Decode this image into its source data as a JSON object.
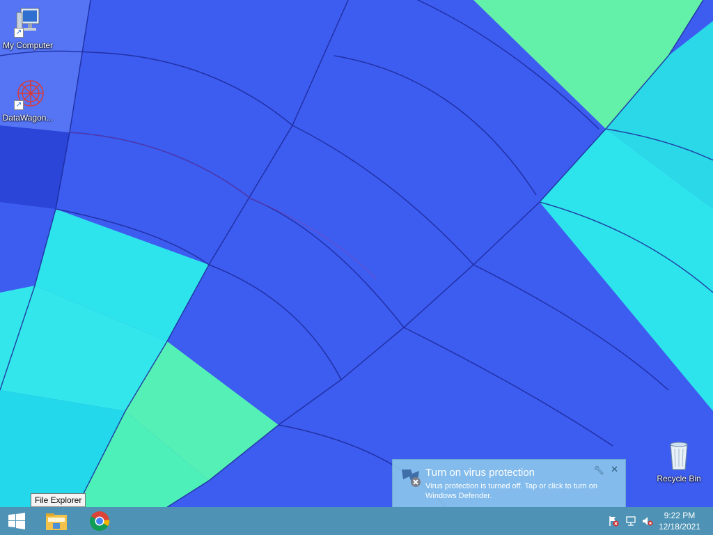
{
  "desktop": {
    "icons": [
      {
        "label": "My Computer"
      },
      {
        "label": "DataWagon..."
      },
      {
        "label": "Recycle Bin"
      }
    ]
  },
  "tooltip": {
    "text": "File Explorer"
  },
  "notification": {
    "title": "Turn on virus protection",
    "body": "Virus protection is turned off. Tap or click to turn on Windows Defender."
  },
  "taskbar": {
    "clock": {
      "time": "9:22 PM",
      "date": "12/18/2021"
    },
    "pinned": [
      "start-icon",
      "file-explorer-icon",
      "chrome-icon"
    ],
    "tray": [
      "action-center-flag-icon",
      "network-icon",
      "volume-muted-icon"
    ]
  }
}
